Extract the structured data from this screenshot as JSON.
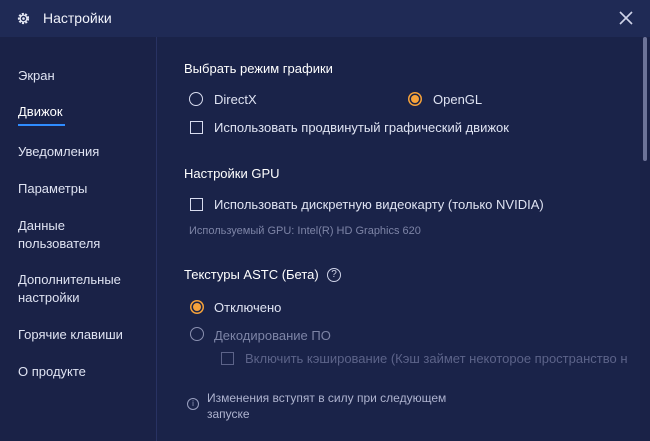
{
  "window": {
    "title": "Настройки"
  },
  "sidebar": {
    "items": [
      {
        "label": "Экран"
      },
      {
        "label": "Движок"
      },
      {
        "label": "Уведомления"
      },
      {
        "label": "Параметры"
      },
      {
        "label": "Данные\nпользователя"
      },
      {
        "label": "Дополнительные\nнастройки"
      },
      {
        "label": "Горячие клавиши"
      },
      {
        "label": "О продукте"
      }
    ],
    "active_index": 1
  },
  "graphics": {
    "title": "Выбрать режим графики",
    "directx_label": "DirectX",
    "opengl_label": "OpenGL",
    "selected": "OpenGL",
    "advanced_label": "Использовать продвинутый графический движок",
    "advanced_checked": false
  },
  "gpu": {
    "title": "Настройки GPU",
    "discrete_label": "Использовать дискретную видеокарту (только NVIDIA)",
    "discrete_checked": false,
    "used_gpu": "Используемый GPU: Intel(R) HD Graphics 620"
  },
  "astc": {
    "title": "Текстуры ASTC (Бета)",
    "help_glyph": "?",
    "disabled_label": "Отключено",
    "decode_label": "Декодирование ПО",
    "selected": "Отключено",
    "cache_label": "Включить кэширование (Кэш займет некоторое пространство н",
    "cache_checked": false
  },
  "notice": {
    "icon_glyph": "i",
    "text": "Изменения вступят в силу при следующем запуске"
  },
  "colors": {
    "accent_orange": "#f6a23a",
    "active_underline": "#2f8cff",
    "background": "#1a2247"
  }
}
